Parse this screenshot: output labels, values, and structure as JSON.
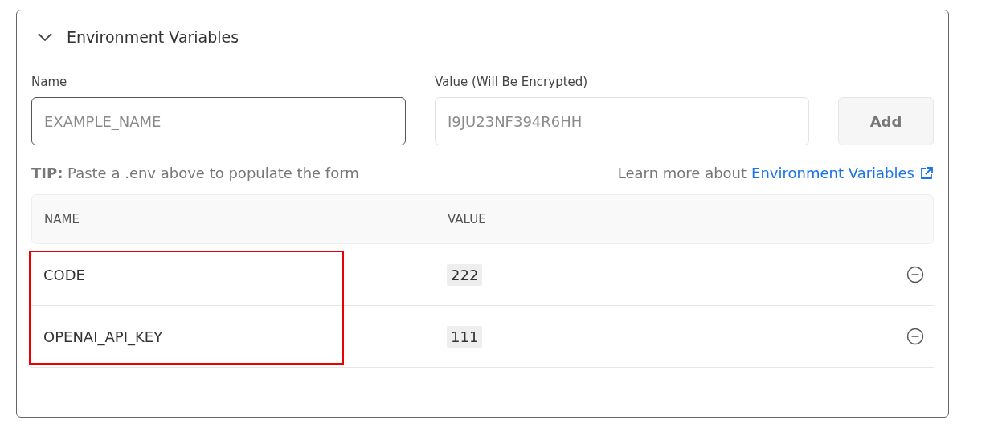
{
  "section": {
    "title": "Environment Variables",
    "expanded": true
  },
  "form": {
    "name_label": "Name",
    "name_placeholder": "EXAMPLE_NAME",
    "value_label": "Value (Will Be Encrypted)",
    "value_placeholder": "I9JU23NF394R6HH",
    "add_button": "Add"
  },
  "tip": {
    "label": "TIP:",
    "text": "Paste a .env above to populate the form"
  },
  "learn_more": {
    "text": "Learn more about",
    "link": "Environment Variables"
  },
  "table": {
    "columns": [
      "NAME",
      "VALUE"
    ],
    "rows": [
      {
        "name": "CODE",
        "value": "222"
      },
      {
        "name": "OPENAI_API_KEY",
        "value": "111"
      }
    ]
  }
}
